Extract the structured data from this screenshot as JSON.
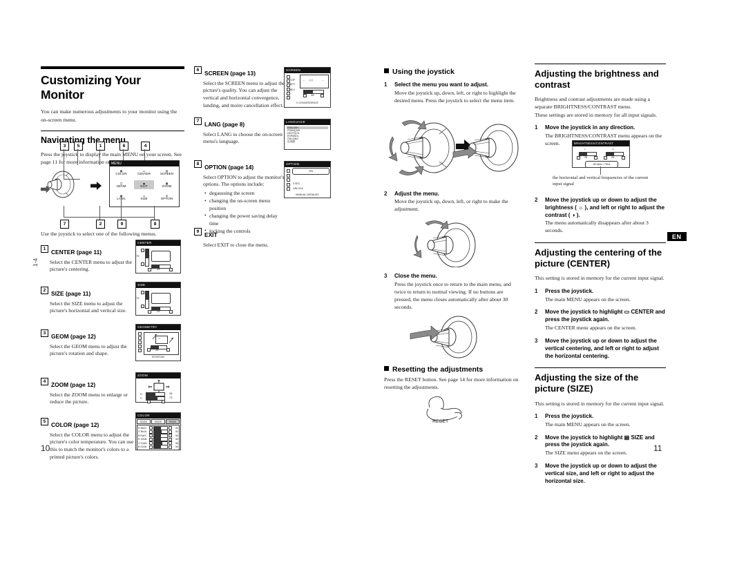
{
  "document": {
    "left_page_number": "10",
    "right_page_number": "11",
    "side_mark": "1-4",
    "language_badge": "EN"
  },
  "col1": {
    "title": "Customizing Your Monitor",
    "intro": "You can make numerous adjustments to your monitor using the on-screen menu.",
    "section_title": "Navigating the menu",
    "section_intro": "Press the joystick to display the main MENU on your screen. See page 11 for more information on using the joystick.",
    "after_diagram": "Use the joystick to select one of the following menus.",
    "menu_diagram": {
      "title": "MENU",
      "cells": [
        {
          "label": "COLOR",
          "icon": "color-icon",
          "flag": "5"
        },
        {
          "label": "CENTER",
          "icon": "center-icon",
          "flag": "1"
        },
        {
          "label": "SCREEN",
          "icon": "screen-icon",
          "flag": "6"
        },
        {
          "label": "GEOM",
          "icon": "geom-icon",
          "flag": "3"
        },
        {
          "label": "EXIT",
          "icon": "exit-icon",
          "flag": "9"
        },
        {
          "label": "ZOOM",
          "icon": "zoom-icon",
          "flag": "4"
        },
        {
          "label": "LANG",
          "icon": "lang-icon",
          "flag": "7"
        },
        {
          "label": "SIZE",
          "icon": "size-icon",
          "flag": "2"
        },
        {
          "label": "OPTION",
          "icon": "option-icon",
          "flag": "8"
        }
      ],
      "flags_top": [
        "3",
        "5",
        "1",
        "6",
        "4"
      ],
      "flags_bottom": [
        "7",
        "2",
        "9",
        "8"
      ]
    },
    "items": [
      {
        "num": "1",
        "title": "CENTER (page 11)",
        "desc": "Select the CENTER menu to adjust the picture's centering.",
        "osd": {
          "title": "CENTER",
          "values": [
            "75",
            "28"
          ]
        }
      },
      {
        "num": "2",
        "title": "SIZE (page 11)",
        "desc": "Select the SIZE menu to adjust the picture's horizontal and vertical size.",
        "osd": {
          "title": "SIZE",
          "values": [
            "73",
            "29"
          ]
        }
      },
      {
        "num": "3",
        "title": "GEOM (page 12)",
        "desc": "Select the GEOM menu to adjust the picture's rotation and shape.",
        "osd": {
          "title": "GEOMETRY",
          "values": [
            "28"
          ],
          "footer": "ROTATION"
        }
      },
      {
        "num": "4",
        "title": "ZOOM (page 12)",
        "desc": "Select the ZOOM menu to enlarge or reduce the picture.",
        "osd": {
          "title": "ZOOM",
          "rows": [
            {
              "label": "H",
              "value": "28"
            },
            {
              "label": "V",
              "value": "73"
            }
          ]
        }
      },
      {
        "num": "5",
        "title": "COLOR (page 12)",
        "desc": "Select the COLOR menu to adjust the picture's color temperature. You can use this to match the monitor's colors to a printed picture's colors.",
        "osd": {
          "title": "COLOR",
          "tabs": [
            "5000K",
            "6500K",
            "9300K"
          ],
          "rows": [
            {
              "label": "R  BIAS",
              "value": "50"
            },
            {
              "label": "G  BIAS",
              "value": "52"
            },
            {
              "label": "B  BIAS",
              "value": "50"
            },
            {
              "label": "R  GAIN",
              "value": "50"
            },
            {
              "label": "G  GAIN",
              "value": "58"
            },
            {
              "label": "B  GAIN",
              "value": "50"
            }
          ]
        }
      }
    ]
  },
  "col2": {
    "items": [
      {
        "num": "6",
        "title": "SCREEN (page 13)",
        "desc": "Select the SCREEN menu to adjust the picture's quality. You can adjust the vertical and horizontal convergence, landing, and moire cancellation effect.",
        "osd": {
          "title": "SCREEN",
          "labels": [
            "TOP",
            "BOT",
            "ADJ"
          ],
          "value": "28",
          "footer": "H  CONVERGENCE"
        }
      },
      {
        "num": "7",
        "title": "LANG (page 8)",
        "desc": "Select LANG to choose the on-screen menu's language.",
        "osd": {
          "title": "LANGUAGE",
          "options": [
            "ENGLISH",
            "FRANÇAIS",
            "DEUTSCH",
            "ESPAÑOL",
            "ITALIANO",
            "日本語"
          ],
          "selected": "ENGLISH"
        }
      },
      {
        "num": "8",
        "title": "OPTION (page 14)",
        "desc": "Select OPTION to adjust the monitor's options. The options include:",
        "bullets": [
          "degaussing the screen",
          "changing the on-screen menu position",
          "changing the power saving delay time",
          "locking the controls"
        ],
        "osd": {
          "title": "OPTION",
          "value_on": "ON",
          "rows": [
            {
              "label": "5 SEC"
            },
            {
              "label": "UNLOCK"
            }
          ],
          "footer": "MANUAL DEGAUSS"
        }
      },
      {
        "num": "9",
        "title": "EXIT",
        "desc": "Select EXIT to close the menu."
      }
    ]
  },
  "col3": {
    "heading": "Using the joystick",
    "steps": [
      {
        "n": "1",
        "bold": "Select the menu you want to adjust.",
        "text": "Move the joystick up, down, left, or right to highlight the desired menu. Press the joystick to select the menu item."
      },
      {
        "n": "2",
        "bold": "Adjust the menu.",
        "text": "Move the joystick up, down, left, or right to make the adjustment."
      },
      {
        "n": "3",
        "bold": "Close the menu.",
        "text": "Press the joystick once to return to the main menu, and twice to return to normal viewing. If no buttons are pressed, the menu closes automatically after about 30 seconds."
      }
    ],
    "reset_heading": "Resetting the adjustments",
    "reset_text": "Press the RESET button. See page 14 for more information on resetting the adjustments.",
    "reset_label": "RESET"
  },
  "col4": {
    "brightness": {
      "title": "Adjusting the brightness and contrast",
      "intro1": "Brightness and contrast adjustments are made using a separate BRIGHTNESS/CONTRAST menu.",
      "intro2": "These settings are stored in memory for all input signals.",
      "steps": [
        {
          "n": "1",
          "bold": "Move the joystick in any direction.",
          "text": "The BRIGHTNESS/CONTRAST menu appears on the screen."
        },
        {
          "n": "2",
          "bold": "Move the joystick up or down to adjust the brightness ( ☼ ), and left or right to adjust the contrast ( ◑ ).",
          "text": "The menu automatically disappears after about 3 seconds."
        }
      ],
      "osd": {
        "title": "BRIGHTNESS/CONTRAST",
        "values": [
          "28",
          "28"
        ],
        "freq": "80.0kHz / 75Hz"
      },
      "caption": "the horizontal and vertical frequencies of the current input signal"
    },
    "center": {
      "title": "Adjusting the centering of the picture (CENTER)",
      "intro": "This setting is stored in memory for the current input signal.",
      "steps": [
        {
          "n": "1",
          "bold": "Press the joystick.",
          "text": "The main MENU appears on the screen."
        },
        {
          "n": "2",
          "bold": "Move the joystick to highlight ▭ CENTER and press the joystick again.",
          "text": "The CENTER menu appears on the screen."
        },
        {
          "n": "3",
          "bold": "Move the joystick up or down to adjust the vertical centering, and left or right to adjust the horizontal centering.",
          "text": ""
        }
      ]
    },
    "size": {
      "title": "Adjusting the size of the picture (SIZE)",
      "intro": "This setting is stored in memory for the current input signal.",
      "steps": [
        {
          "n": "1",
          "bold": "Press the joystick.",
          "text": "The main MENU appears on the screen."
        },
        {
          "n": "2",
          "bold": "Move the joystick to highlight ▤ SIZE and press the joystick again.",
          "text": "The SIZE menu appears on the screen."
        },
        {
          "n": "3",
          "bold": "Move the joystick up or down to adjust the vertical size, and left or right to adjust the horizontal size.",
          "text": ""
        }
      ]
    }
  }
}
